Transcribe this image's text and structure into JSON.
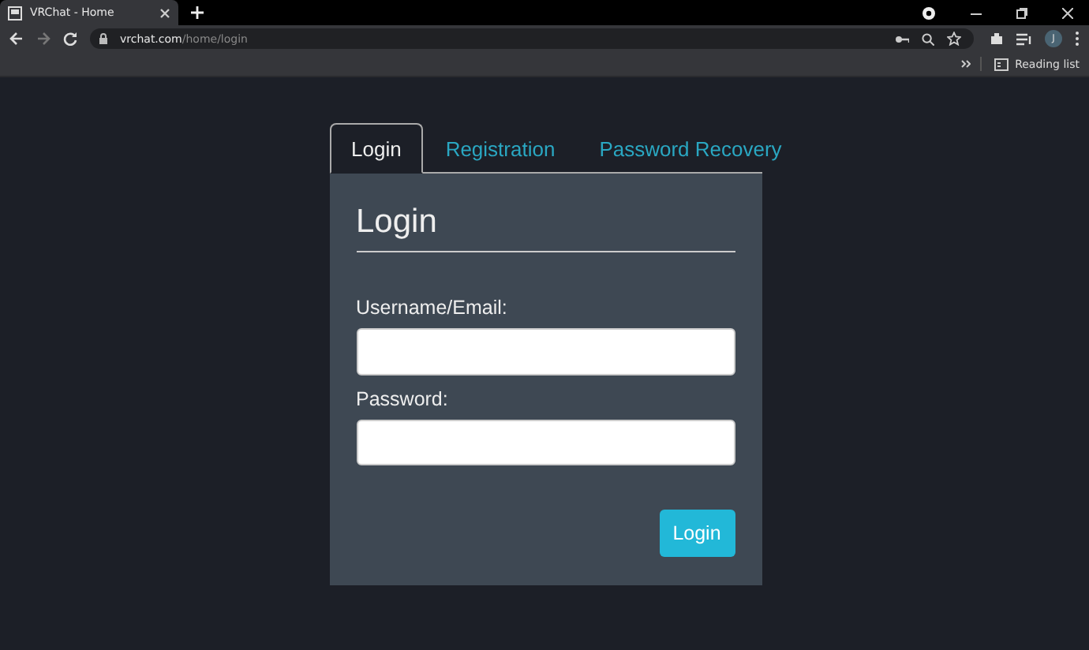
{
  "browser": {
    "tab_title": "VRChat - Home",
    "url_host": "vrchat.com",
    "url_path": "/home/login",
    "avatar": "J",
    "reading_list": "Reading list"
  },
  "tabs": [
    {
      "label": "Login",
      "selected": true
    },
    {
      "label": "Registration",
      "selected": false
    },
    {
      "label": "Password Recovery",
      "selected": false
    }
  ],
  "form": {
    "heading": "Login",
    "fields": [
      {
        "label": "Username/Email:"
      },
      {
        "label": "Password:"
      }
    ],
    "submit": "Login"
  }
}
